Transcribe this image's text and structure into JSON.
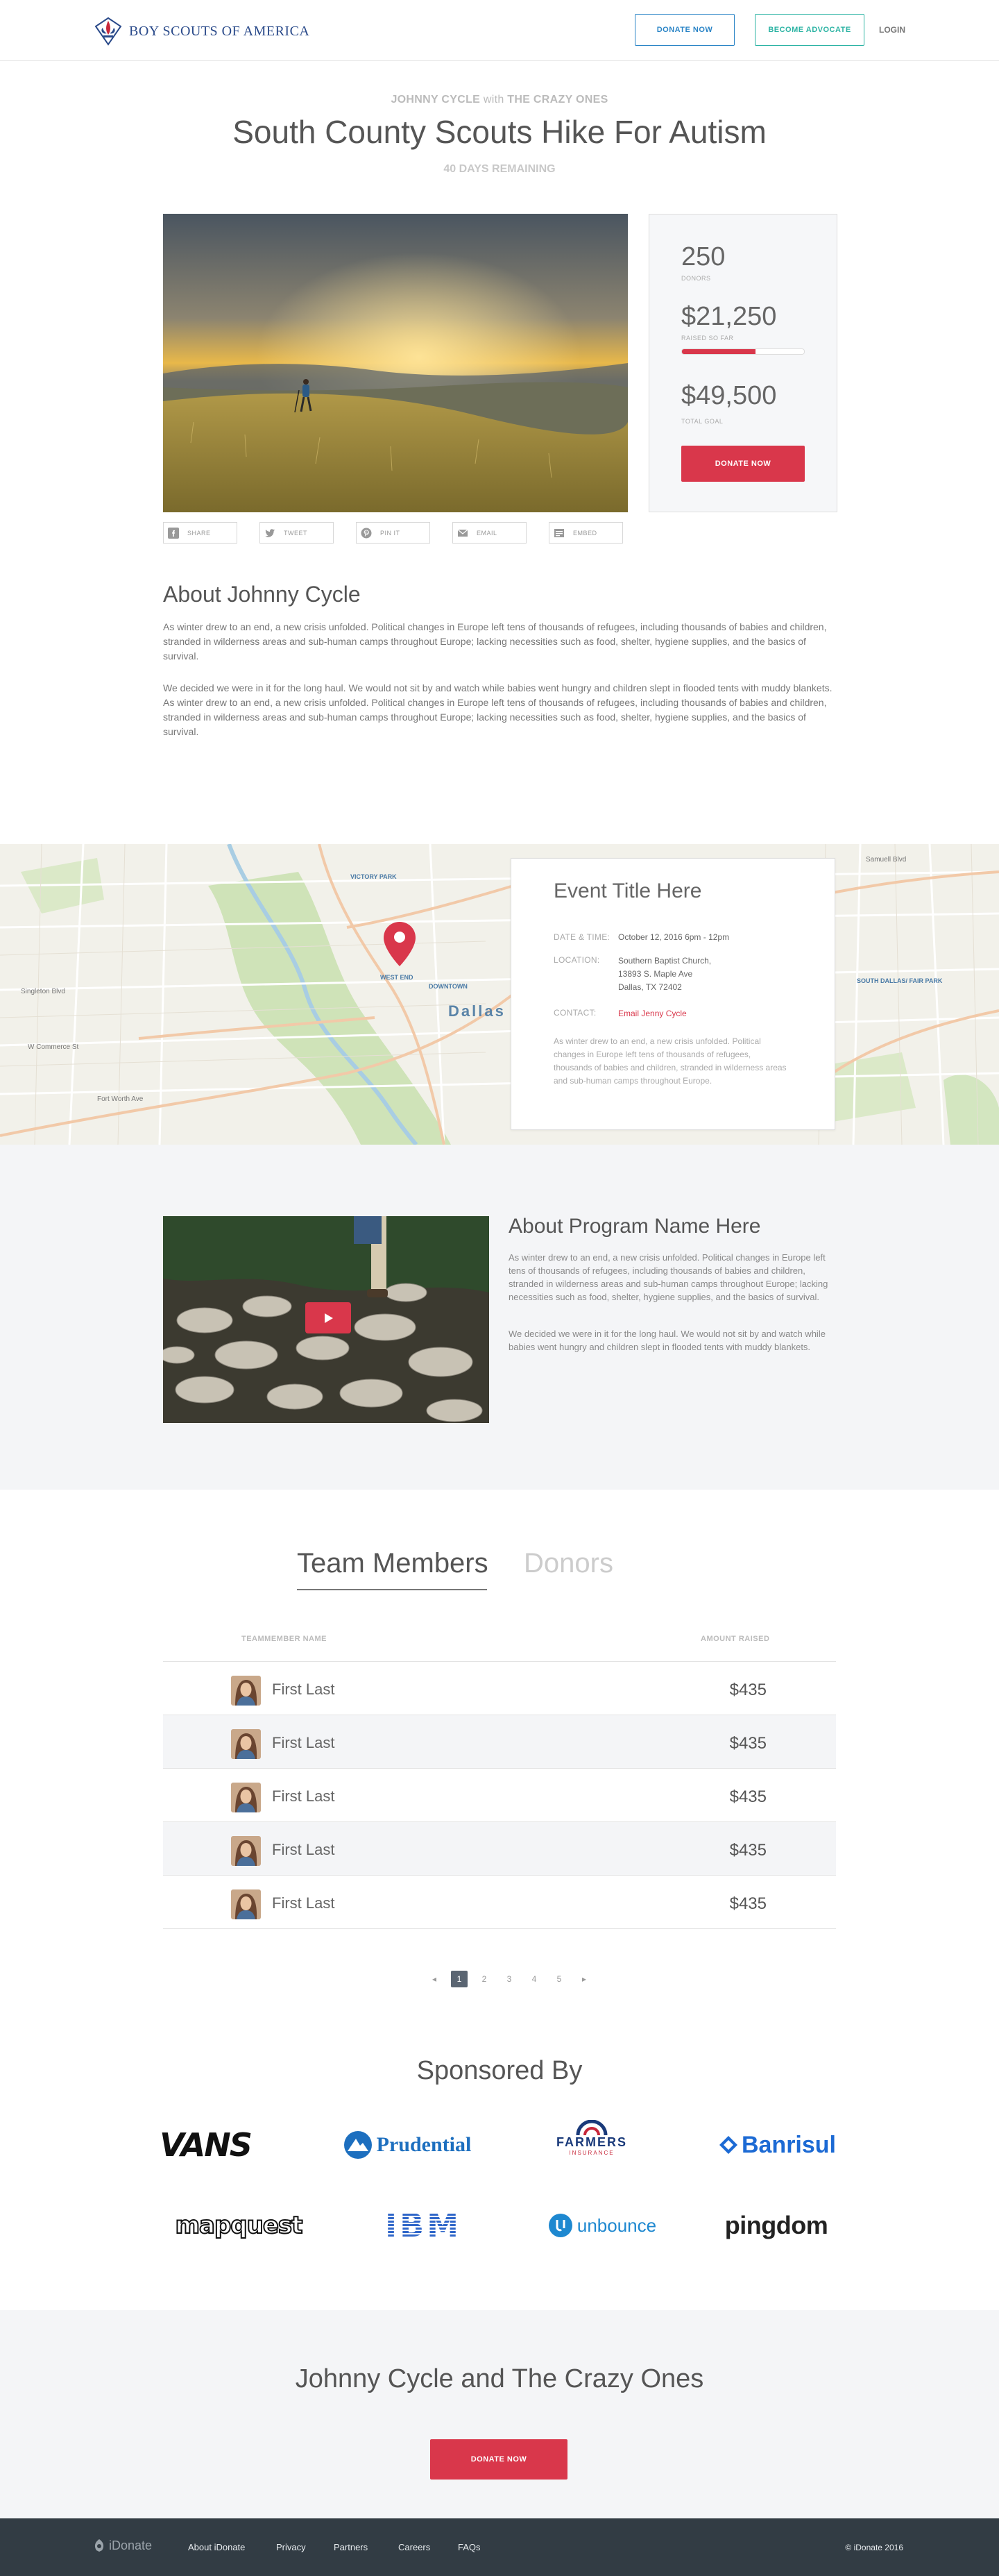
{
  "header": {
    "logo_text": "BOY SCOUTS OF AMERICA",
    "donate_label": "DONATE NOW",
    "advocate_label": "BECOME ADVOCATE",
    "login_label": "LOGIN"
  },
  "hero": {
    "fundraiser": "JOHNNY CYCLE",
    "with": "with",
    "team": "THE CRAZY ONES",
    "title": "South County Scouts Hike For  Autism",
    "days_remaining": "40 DAYS REMAINING"
  },
  "stats": {
    "donors_value": "250",
    "donors_label": "DONORS",
    "raised_value": "$21,250",
    "raised_label": "RAISED SO FAR",
    "progress_fraction": 0.6,
    "goal_value": "$49,500",
    "goal_label": "TOTAL GOAL",
    "donate_label": "DONATE NOW"
  },
  "shares": [
    {
      "label": "SHARE",
      "icon": "facebook-icon"
    },
    {
      "label": "TWEET",
      "icon": "twitter-icon"
    },
    {
      "label": "PIN IT",
      "icon": "pinterest-icon"
    },
    {
      "label": "EMAIL",
      "icon": "email-icon"
    },
    {
      "label": "EMBED",
      "icon": "embed-icon"
    }
  ],
  "about": {
    "title": "About Johnny Cycle",
    "p1": "As winter drew to an end, a new crisis unfolded. Political changes in Europe left tens of thousands of refugees, including thousands of babies and children, stranded in wilderness areas and sub-human camps throughout Europe; lacking necessities such as food, shelter, hygiene supplies, and the basics of survival.",
    "p2": "We decided we were in it for the long haul. We would not sit by and watch while babies went hungry and children slept in flooded tents with muddy blankets. As winter drew to an end, a new crisis unfolded. Political changes in Europe left tens of thousands of refugees, including thousands of babies and children, stranded in wilderness areas and sub-human camps throughout Europe; lacking necessities such as food, shelter, hygiene supplies, and the basics of survival."
  },
  "map": {
    "city_label": "Dallas",
    "labels": [
      "VICTORY PARK",
      "WEST END",
      "DOWNTOWN",
      "SOUTH DALLAS/ FAIR PARK",
      "Singleton Blvd",
      "W Commerce St",
      "Fort Worth Ave",
      "Samuell Blvd"
    ]
  },
  "event": {
    "title": "Event Title Here",
    "date_label": "DATE & TIME:",
    "date_value": "October 12, 2016 6pm - 12pm",
    "location_label": "LOCATION:",
    "location_lines": [
      "Southern Baptist Church,",
      "13893 S. Maple Ave",
      "Dallas,  TX 72402"
    ],
    "contact_label": "CONTACT:",
    "contact_value": "Email Jenny Cycle",
    "description": "As winter drew to an end, a new crisis unfolded. Political changes in Europe left tens of thousands of refugees, thousands of babies and children, stranded in wilderness areas and sub-human camps throughout Europe."
  },
  "program": {
    "title": "About Program Name Here",
    "p1": "As winter drew to an end, a new crisis unfolded. Political changes in Europe left tens of thousands of refugees, including thousands of babies and children, stranded in wilderness areas and sub-human camps throughout Europe; lacking necessities such as food, shelter, hygiene supplies, and the basics of survival.",
    "p2": "We decided we were in it for the long haul. We would not sit by and watch while babies went hungry and children slept in flooded tents with muddy blankets."
  },
  "team": {
    "tab_active": "Team Members",
    "tab_inactive": "Donors",
    "col_name": "TEAMMEMBER NAME",
    "col_amount": "AMOUNT RAISED",
    "rows": [
      {
        "name": "First Last",
        "amount": "$435"
      },
      {
        "name": "First Last",
        "amount": "$435"
      },
      {
        "name": "First Last",
        "amount": "$435"
      },
      {
        "name": "First Last",
        "amount": "$435"
      },
      {
        "name": "First Last",
        "amount": "$435"
      }
    ],
    "pager": {
      "prev": "◂",
      "pages": [
        "1",
        "2",
        "3",
        "4",
        "5"
      ],
      "next": "▸",
      "current": "1"
    }
  },
  "sponsors": {
    "title": "Sponsored By",
    "items": [
      "VANS",
      "Prudential",
      "FARMERS",
      "INSURANCE",
      "Banrisul",
      "mapquest",
      "IBM",
      "unbounce",
      "pingdom"
    ]
  },
  "cta": {
    "title": "Johnny Cycle and The Crazy Ones",
    "button": "DONATE NOW"
  },
  "footer": {
    "logo": "iDonate",
    "links": [
      "About iDonate",
      "Privacy",
      "Partners",
      "Careers",
      "FAQs"
    ],
    "copyright": "© iDonate 2016"
  },
  "colors": {
    "accent_red": "#d9374b",
    "blue": "#2a84c6",
    "teal": "#2bb3a3",
    "footer_bg": "#323c44"
  }
}
